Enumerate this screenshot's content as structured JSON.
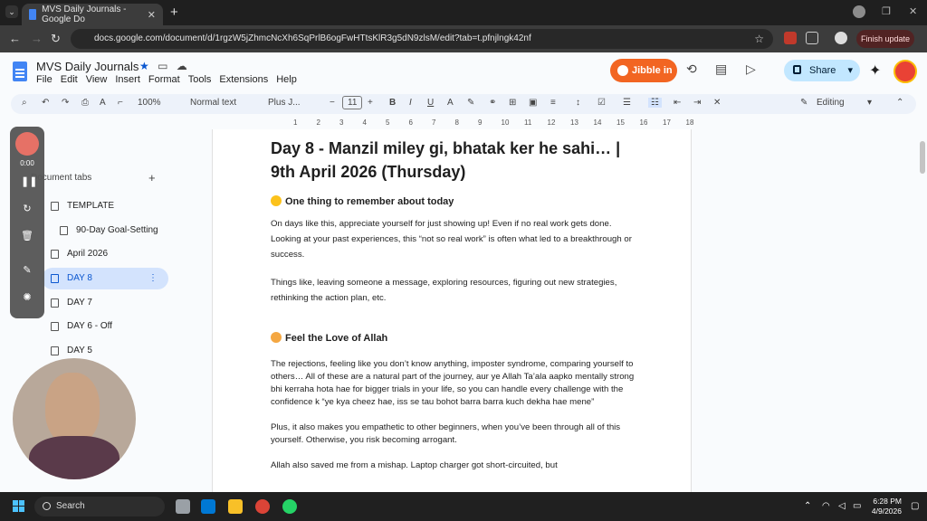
{
  "browser": {
    "tab_title": "MVS Daily Journals - Google Do",
    "url": "docs.google.com/document/d/1rgzW5jZhmcNcXh6SqPrlB6ogFwHTtsKlR3g5dN9zlsM/edit?tab=t.pfnjlngk42nf",
    "finish_update": "Finish update"
  },
  "docs": {
    "title": "MVS Daily Journals",
    "menus": [
      "File",
      "Edit",
      "View",
      "Insert",
      "Format",
      "Tools",
      "Extensions",
      "Help"
    ],
    "jibble": "Jibble in",
    "share": "Share",
    "toolbar": {
      "zoom": "100%",
      "style": "Normal text",
      "font": "Plus J...",
      "font_size": "11",
      "mode": "Editing"
    }
  },
  "sidebar": {
    "header": "Document tabs",
    "items": [
      {
        "label": "TEMPLATE"
      },
      {
        "label": "90-Day Goal-Setting"
      },
      {
        "label": "April 2026"
      },
      {
        "label": "DAY 8"
      },
      {
        "label": "DAY 7"
      },
      {
        "label": "DAY 6 - Off"
      },
      {
        "label": "DAY 5"
      }
    ]
  },
  "recorder": {
    "time": "0:00"
  },
  "document": {
    "heading": "Day 8 - Manzil miley gi, bhatak ker he sahi… | 9th April 2026 (Thursday)",
    "section1": "One thing to remember about today",
    "p1": "On days like this, appreciate yourself for just showing up! Even if no real work gets done. Looking at your past experiences, this “not so real work” is often what led to a breakthrough or success.",
    "p2": "Things like, leaving someone a message, exploring resources, figuring out new strategies, rethinking the action plan, etc.",
    "section2": "Feel the Love of Allah",
    "p3": "The rejections, feeling like you don’t know anything, imposter syndrome, comparing yourself to others… All of these are a natural part of the journey, aur ye Allah Ta’ala aapko mentally strong bhi kerraha hota hae for bigger trials in your life, so you can handle every challenge with the confidence k “ye kya cheez hae, iss se tau bohot barra barra kuch dekha hae mene”",
    "p4": "Plus, it also makes you empathetic to other beginners, when you’ve been through all of this yourself. Otherwise, you risk becoming arrogant.",
    "p5": "Allah also saved me from a mishap. Laptop charger got short-circuited, but"
  },
  "taskbar": {
    "search": "Search",
    "time": "6:28 PM",
    "date": "4/9/2026"
  },
  "colors": {
    "accent": "#0b57d0",
    "jibble": "#f26522",
    "share_bg": "#c2e7ff"
  }
}
